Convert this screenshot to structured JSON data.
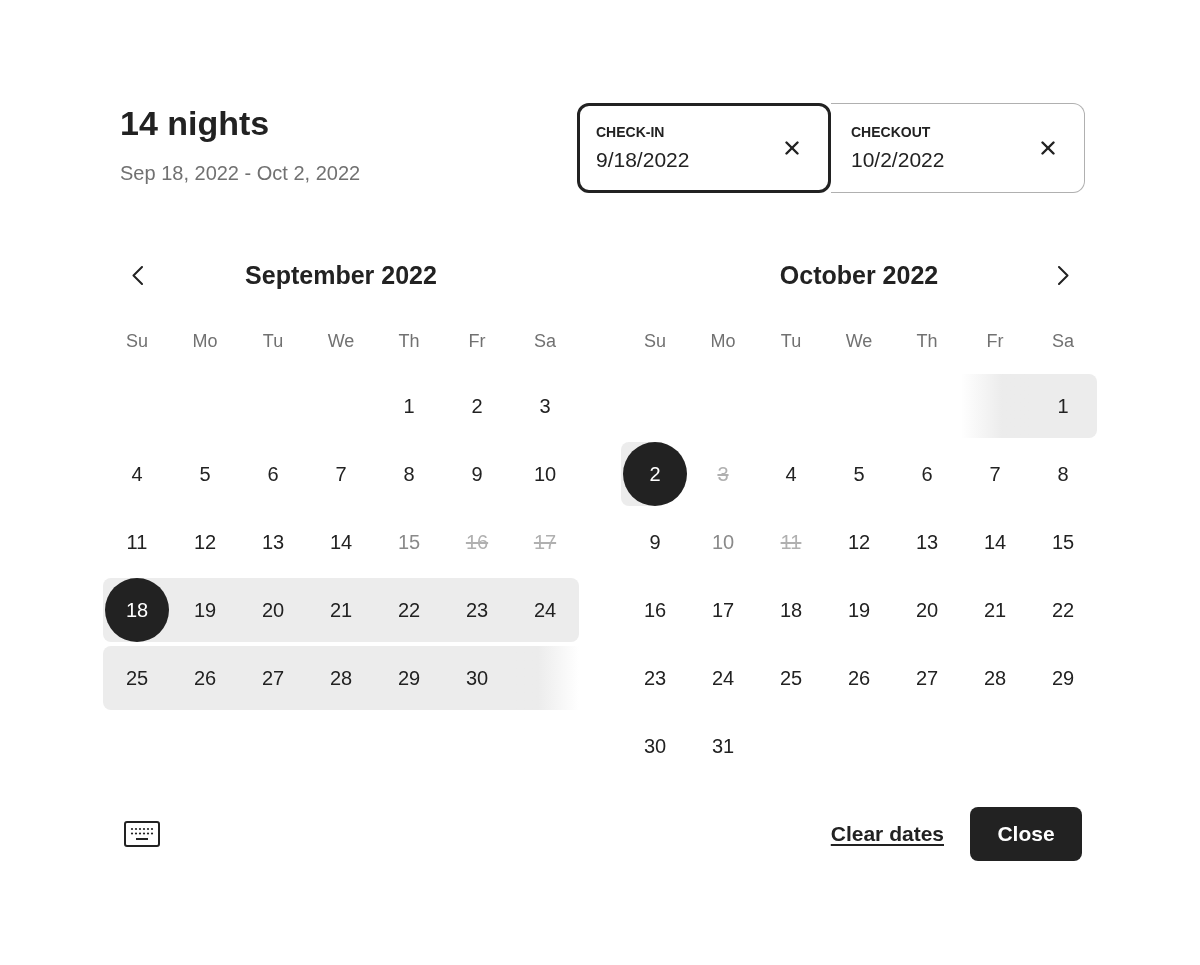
{
  "summary": {
    "title": "14 nights",
    "dates": "Sep 18, 2022 - Oct 2, 2022"
  },
  "date_fields": [
    {
      "label": "CHECK-IN",
      "value": "9/18/2022",
      "selected": true
    },
    {
      "label": "CHECKOUT",
      "value": "10/2/2022",
      "selected": false
    }
  ],
  "months": [
    {
      "title": "September 2022",
      "weekdays": [
        "Su",
        "Mo",
        "Tu",
        "We",
        "Th",
        "Fr",
        "Sa"
      ],
      "weeks": [
        [
          {
            "day": "1",
            "kind": "open",
            "selected": false,
            "in_range": false
          },
          {
            "day": "2",
            "kind": "open",
            "selected": false,
            "in_range": false
          },
          {
            "day": "3",
            "kind": "open",
            "selected": false,
            "in_range": false
          }
        ],
        [
          {
            "day": "4",
            "kind": "open",
            "selected": false,
            "in_range": false
          },
          {
            "day": "5",
            "kind": "open",
            "selected": false,
            "in_range": false
          },
          {
            "day": "6",
            "kind": "open",
            "selected": false,
            "in_range": false
          },
          {
            "day": "7",
            "kind": "open",
            "selected": false,
            "in_range": false
          },
          {
            "day": "8",
            "kind": "open",
            "selected": false,
            "in_range": false
          },
          {
            "day": "9",
            "kind": "open",
            "selected": false,
            "in_range": false
          },
          {
            "day": "10",
            "kind": "open",
            "selected": false,
            "in_range": false
          }
        ],
        [
          {
            "day": "11",
            "kind": "open",
            "selected": false,
            "in_range": false
          },
          {
            "day": "12",
            "kind": "open",
            "selected": false,
            "in_range": false
          },
          {
            "day": "13",
            "kind": "open",
            "selected": false,
            "in_range": false
          },
          {
            "day": "14",
            "kind": "open",
            "selected": false,
            "in_range": false
          },
          {
            "day": "15",
            "kind": "muted",
            "selected": false,
            "in_range": false
          },
          {
            "day": "16",
            "kind": "struck",
            "selected": false,
            "in_range": false
          },
          {
            "day": "17",
            "kind": "struck",
            "selected": false,
            "in_range": false
          }
        ],
        [
          {
            "day": "18",
            "kind": "open",
            "selected": true,
            "in_range": true
          },
          {
            "day": "19",
            "kind": "open",
            "selected": false,
            "in_range": true
          },
          {
            "day": "20",
            "kind": "open",
            "selected": false,
            "in_range": true
          },
          {
            "day": "21",
            "kind": "open",
            "selected": false,
            "in_range": true
          },
          {
            "day": "22",
            "kind": "open",
            "selected": false,
            "in_range": true
          },
          {
            "day": "23",
            "kind": "open",
            "selected": false,
            "in_range": true
          },
          {
            "day": "24",
            "kind": "open",
            "selected": false,
            "in_range": true
          }
        ],
        [
          {
            "day": "25",
            "kind": "open",
            "selected": false,
            "in_range": true
          },
          {
            "day": "26",
            "kind": "open",
            "selected": false,
            "in_range": true
          },
          {
            "day": "27",
            "kind": "open",
            "selected": false,
            "in_range": true
          },
          {
            "day": "28",
            "kind": "open",
            "selected": false,
            "in_range": true
          },
          {
            "day": "29",
            "kind": "open",
            "selected": false,
            "in_range": true
          },
          {
            "day": "30",
            "kind": "open",
            "selected": false,
            "in_range": true
          }
        ]
      ]
    },
    {
      "title": "October 2022",
      "weekdays": [
        "Su",
        "Mo",
        "Tu",
        "We",
        "Th",
        "Fr",
        "Sa"
      ],
      "weeks": [
        [
          {
            "day": "1",
            "kind": "open",
            "selected": false,
            "in_range": true
          }
        ],
        [
          {
            "day": "2",
            "kind": "open",
            "selected": true,
            "in_range": true
          },
          {
            "day": "3",
            "kind": "struck",
            "selected": false,
            "in_range": false
          },
          {
            "day": "4",
            "kind": "open",
            "selected": false,
            "in_range": false
          },
          {
            "day": "5",
            "kind": "open",
            "selected": false,
            "in_range": false
          },
          {
            "day": "6",
            "kind": "open",
            "selected": false,
            "in_range": false
          },
          {
            "day": "7",
            "kind": "open",
            "selected": false,
            "in_range": false
          },
          {
            "day": "8",
            "kind": "open",
            "selected": false,
            "in_range": false
          }
        ],
        [
          {
            "day": "9",
            "kind": "open",
            "selected": false,
            "in_range": false
          },
          {
            "day": "10",
            "kind": "muted",
            "selected": false,
            "in_range": false
          },
          {
            "day": "11",
            "kind": "struck",
            "selected": false,
            "in_range": false
          },
          {
            "day": "12",
            "kind": "open",
            "selected": false,
            "in_range": false
          },
          {
            "day": "13",
            "kind": "open",
            "selected": false,
            "in_range": false
          },
          {
            "day": "14",
            "kind": "open",
            "selected": false,
            "in_range": false
          },
          {
            "day": "15",
            "kind": "open",
            "selected": false,
            "in_range": false
          }
        ],
        [
          {
            "day": "16",
            "kind": "open",
            "selected": false,
            "in_range": false
          },
          {
            "day": "17",
            "kind": "open",
            "selected": false,
            "in_range": false
          },
          {
            "day": "18",
            "kind": "open",
            "selected": false,
            "in_range": false
          },
          {
            "day": "19",
            "kind": "open",
            "selected": false,
            "in_range": false
          },
          {
            "day": "20",
            "kind": "open",
            "selected": false,
            "in_range": false
          },
          {
            "day": "21",
            "kind": "open",
            "selected": false,
            "in_range": false
          },
          {
            "day": "22",
            "kind": "open",
            "selected": false,
            "in_range": false
          }
        ],
        [
          {
            "day": "23",
            "kind": "open",
            "selected": false,
            "in_range": false
          },
          {
            "day": "24",
            "kind": "open",
            "selected": false,
            "in_range": false
          },
          {
            "day": "25",
            "kind": "open",
            "selected": false,
            "in_range": false
          },
          {
            "day": "26",
            "kind": "open",
            "selected": false,
            "in_range": false
          },
          {
            "day": "27",
            "kind": "open",
            "selected": false,
            "in_range": false
          },
          {
            "day": "28",
            "kind": "open",
            "selected": false,
            "in_range": false
          },
          {
            "day": "29",
            "kind": "open",
            "selected": false,
            "in_range": false
          }
        ],
        [
          {
            "day": "30",
            "kind": "open",
            "selected": false,
            "in_range": false
          },
          {
            "day": "31",
            "kind": "open",
            "selected": false,
            "in_range": false
          }
        ]
      ]
    }
  ],
  "footer": {
    "clear": "Clear dates",
    "close": "Close"
  }
}
